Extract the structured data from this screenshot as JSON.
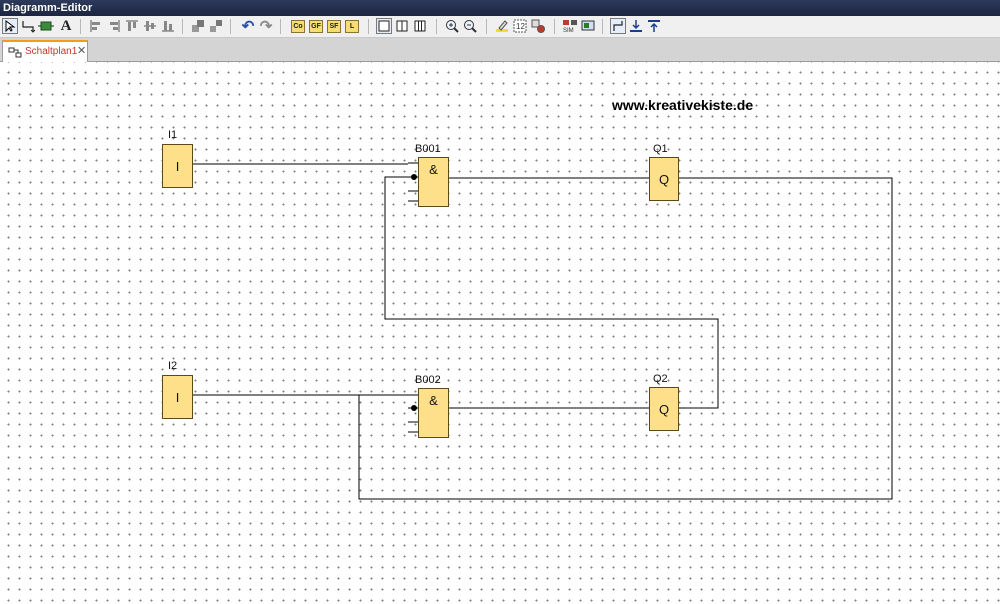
{
  "window": {
    "title": "Diagramm-Editor"
  },
  "toolbar": {
    "buttons": [
      {
        "name": "select-tool-icon"
      },
      {
        "name": "connect-tool-icon"
      },
      {
        "name": "insert-block-icon"
      },
      {
        "name": "text-tool-icon",
        "glyph": "A"
      },
      {
        "name": "align-left-icon"
      },
      {
        "name": "align-right-icon"
      },
      {
        "name": "align-top-icon"
      },
      {
        "name": "align-center-icon"
      },
      {
        "name": "align-bottom-icon"
      },
      {
        "name": "group-icon"
      },
      {
        "name": "ungroup-icon"
      },
      {
        "name": "undo-icon",
        "glyph": "↶"
      },
      {
        "name": "redo-icon",
        "glyph": "↷"
      },
      {
        "name": "co-block-button",
        "label": "Co"
      },
      {
        "name": "gf-block-button",
        "label": "GF"
      },
      {
        "name": "sf-block-button",
        "label": "SF"
      },
      {
        "name": "l-block-button",
        "label": "L"
      },
      {
        "name": "single-view-icon"
      },
      {
        "name": "split-view-icon"
      },
      {
        "name": "triple-view-icon"
      },
      {
        "name": "zoom-in-icon"
      },
      {
        "name": "zoom-out-icon"
      },
      {
        "name": "highlight-icon"
      },
      {
        "name": "number-blocks-icon"
      },
      {
        "name": "settings-icon"
      },
      {
        "name": "simulation-icon"
      },
      {
        "name": "online-test-icon"
      },
      {
        "name": "wire-mode-icon"
      },
      {
        "name": "align-wire-down-icon"
      },
      {
        "name": "align-wire-up-icon"
      }
    ]
  },
  "tab": {
    "label": "Schaltplan1",
    "close": "✕"
  },
  "watermark": "www.kreativekiste.de",
  "blocks": {
    "i1": {
      "label": "I1",
      "symbol": "I"
    },
    "i2": {
      "label": "I2",
      "symbol": "I"
    },
    "b001": {
      "label": "B001",
      "symbol": "&"
    },
    "b002": {
      "label": "B002",
      "symbol": "&"
    },
    "q1": {
      "label": "Q1",
      "symbol": "Q"
    },
    "q2": {
      "label": "Q2",
      "symbol": "Q"
    }
  }
}
